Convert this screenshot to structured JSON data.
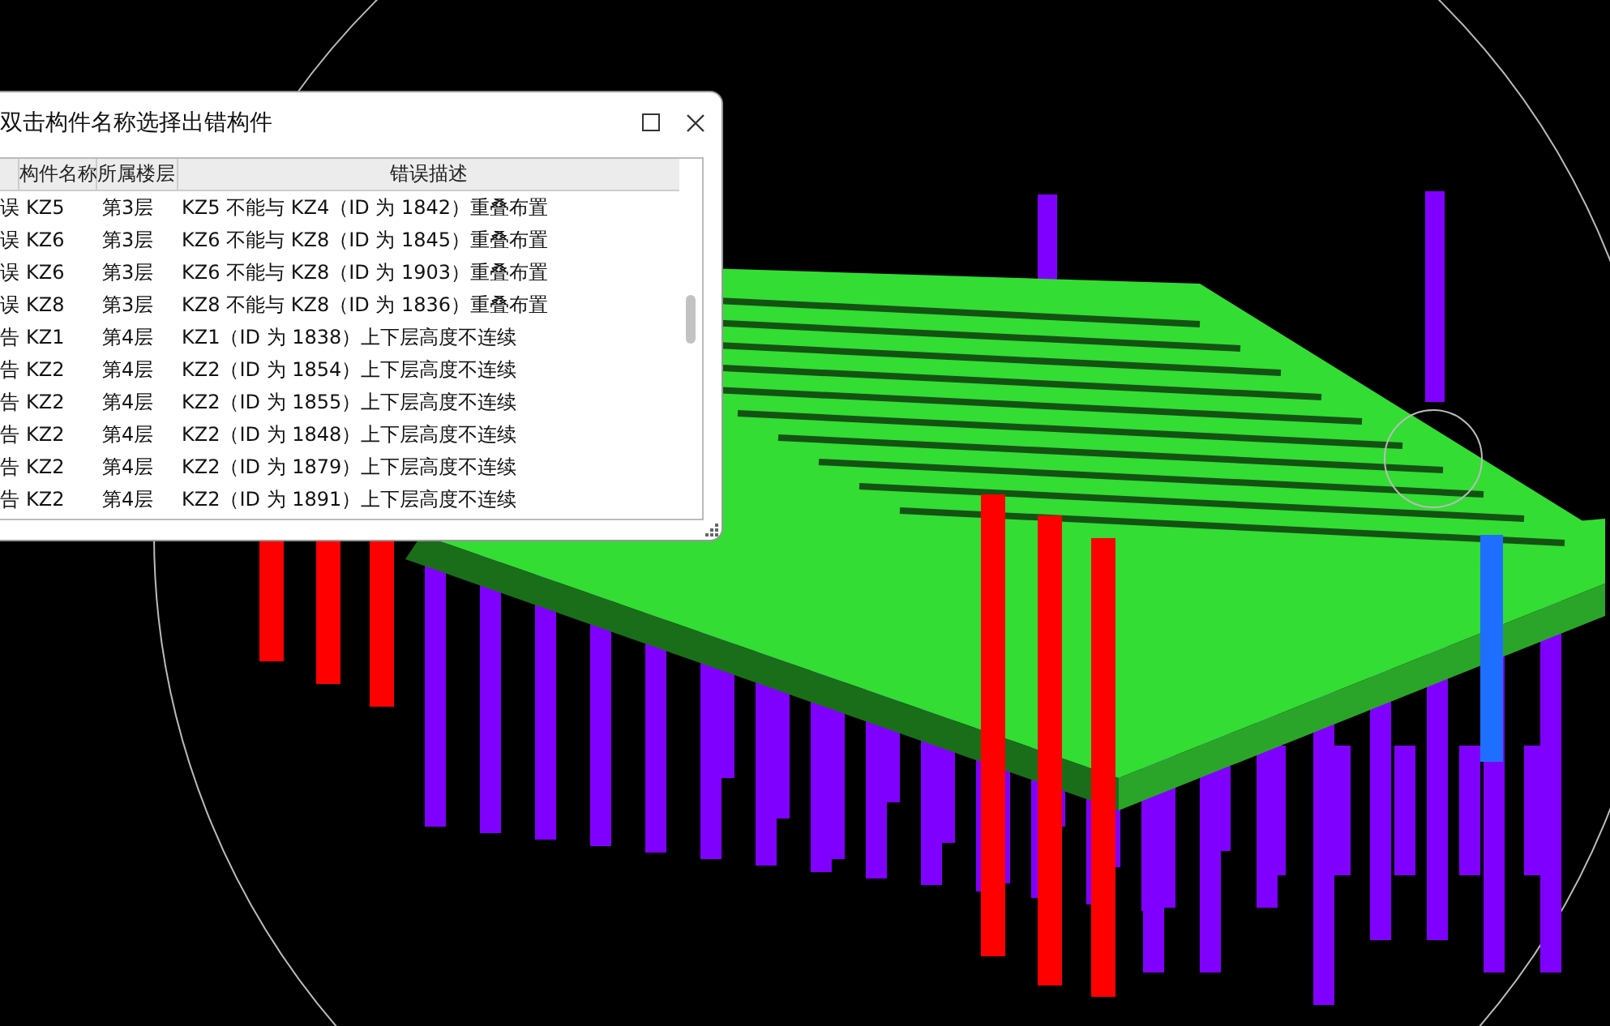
{
  "dialog": {
    "title": "双击构件名称选择出错构件"
  },
  "table": {
    "columns": [
      "构件名称",
      "所属楼层",
      "错误描述"
    ],
    "rows": [
      {
        "column_1": "误",
        "name": "KZ5",
        "floor": "第3层",
        "description": "KZ5 不能与 KZ4（ID 为 1842）重叠布置"
      },
      {
        "column_1": "误",
        "name": "KZ6",
        "floor": "第3层",
        "description": "KZ6 不能与 KZ8（ID 为 1845）重叠布置"
      },
      {
        "column_1": "误",
        "name": "KZ6",
        "floor": "第3层",
        "description": "KZ6 不能与 KZ8（ID 为 1903）重叠布置"
      },
      {
        "column_1": "误",
        "name": "KZ8",
        "floor": "第3层",
        "description": "KZ8 不能与 KZ8（ID 为 1836）重叠布置"
      },
      {
        "column_1": "告",
        "name": "KZ1",
        "floor": "第4层",
        "description": "KZ1（ID 为 1838）上下层高度不连续"
      },
      {
        "column_1": "告",
        "name": "KZ2",
        "floor": "第4层",
        "description": "KZ2（ID 为 1854）上下层高度不连续"
      },
      {
        "column_1": "告",
        "name": "KZ2",
        "floor": "第4层",
        "description": "KZ2（ID 为 1855）上下层高度不连续"
      },
      {
        "column_1": "告",
        "name": "KZ2",
        "floor": "第4层",
        "description": "KZ2（ID 为 1848）上下层高度不连续"
      },
      {
        "column_1": "告",
        "name": "KZ2",
        "floor": "第4层",
        "description": "KZ2（ID 为 1879）上下层高度不连续"
      },
      {
        "column_1": "告",
        "name": "KZ2",
        "floor": "第4层",
        "description": "KZ2（ID 为 1891）上下层高度不连续"
      }
    ]
  }
}
